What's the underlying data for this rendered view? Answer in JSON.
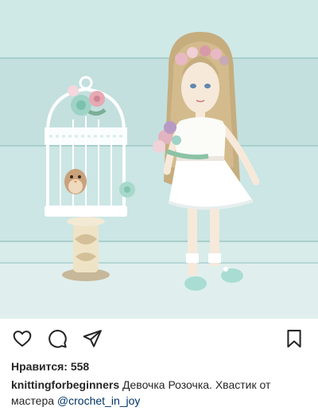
{
  "post": {
    "image_alt": "",
    "likes_label": "Нравится:",
    "likes_count": "558",
    "caption_username": "knittingforbeginners",
    "caption_text": "Девочка Розочка. Хвастик от мастера",
    "caption_mention": "@crochet_in_joy"
  },
  "icons": {
    "like": "heart-outline-icon",
    "comment": "speech-bubble-icon",
    "share": "paper-plane-icon",
    "save": "bookmark-outline-icon"
  },
  "colors": {
    "background_wall": "#c4e2e0",
    "text": "#262626",
    "mention": "#003569"
  }
}
